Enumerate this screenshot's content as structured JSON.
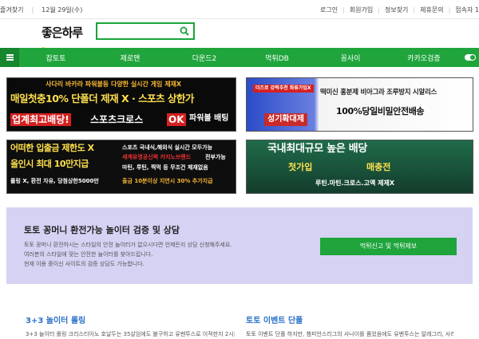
{
  "topbar": {
    "favorites": "즐겨찾기",
    "date": "12월 29일(수)",
    "links": [
      "로그인",
      "회원가입",
      "정보찾기",
      "제휴문의",
      "접속자 1"
    ]
  },
  "header": {
    "logo": "좋은하루",
    "search_placeholder": ""
  },
  "nav": {
    "items": [
      "잡토토",
      "제로맨",
      "다운드2",
      "먹튀DB",
      "꽁사이",
      "카카오검증"
    ]
  },
  "banners": {
    "b1": {
      "line1": "사다리 바카라 파워볼등 다양한 실시간 게임 제재X",
      "line2a": "매일첫충10% 단폴더 제재 X · 스포츠 상한가",
      "line3a": "업계최고배당!",
      "line3b": "스포츠크로스",
      "line3c": "OK",
      "line3d": "파워볼 배팅"
    },
    "b2": {
      "tag": "더즈로 강력추천 화류가입X",
      "head": "떡미신 홍분제 비아그라 조루방지 시알리스",
      "main": "성기확대제",
      "sub": "100%당일비밀안전배송"
    },
    "b3": {
      "line1a": "어떠한 입출금 제한도 X",
      "line1b": "스포츠 국내식,해외식 실시간 모두가능",
      "line2": "세계유명공신력 카지노브랜드",
      "line2b": "전부가능",
      "line3a": "올인시 최대 10만지급",
      "line3b": "마틴, 루틴, 찍먹 등 무조건 제재없음",
      "line4a": "롤링 X, 환전 자유, 당첨상한5000만",
      "line4b": "출금 10분이상 지연시 30% 추가지급"
    },
    "b4": {
      "head": "국내최대규모 높은 배당",
      "left": "첫가입",
      "right": "매충전",
      "sub": "루틴.마틴.크로스.고액 제제X"
    }
  },
  "consult": {
    "title": "토토 꽁머니 환전가능 놀이터 검증 및 상담",
    "lines": [
      "토토 꽁머니 환전하시는 스타일의 안전 놀이터가 없으시다면 언제든지 상담 신청해주세요.",
      "여러분의 스타일에 맞는 안전한 놀이터를 찾아드립니다.",
      "현재 이용 중이신 사이트의 검증 상담도 가능합니다."
    ],
    "button": "먹튀신고 및 먹튀제보"
  },
  "sections": [
    {
      "title": "3+3 놀이터 롤링",
      "text": "3+3 놀이터 롤링 크리스티아노 호날두는 35살임에도 불구하고 유벤투스로 이적한지 2시즌"
    },
    {
      "title": "토토 이벤트 단폴",
      "text": "토토 이벤트 단폴 하지만, 챔피언스리그의 사나이를 품었음에도 유벤투스는 알레그리, 사리"
    }
  ],
  "colors": {
    "brand_green": "#1fa53c",
    "section_blue": "#2a72c8",
    "consult_bg": "#d6d2f4"
  }
}
